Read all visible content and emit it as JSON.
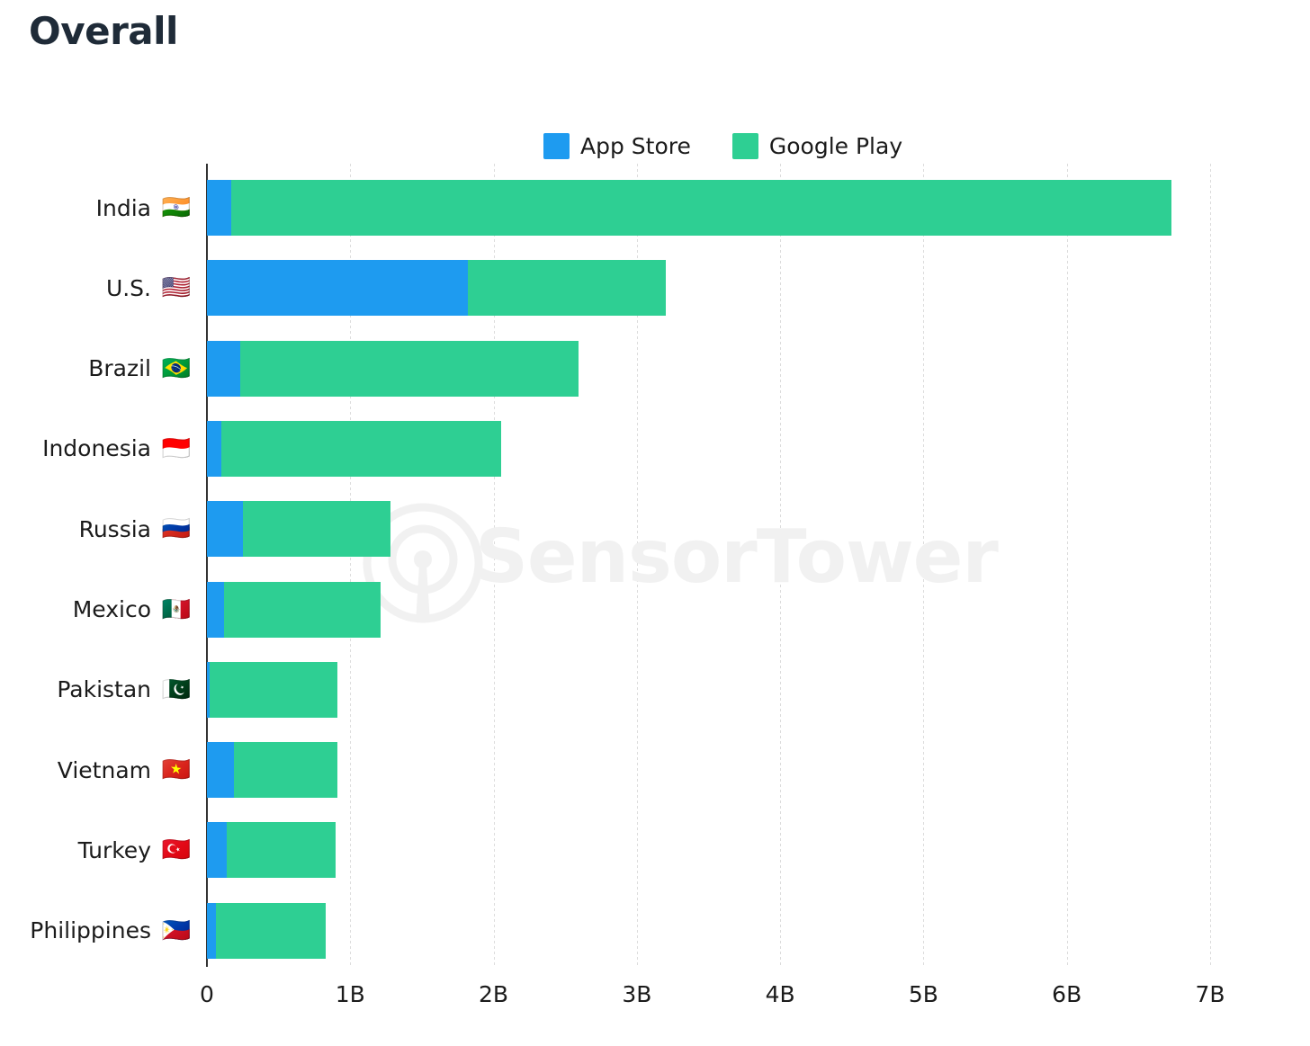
{
  "title": "Overall",
  "watermark": {
    "text": "SensorTower",
    "logo_icon": "sensortower-logo-icon",
    "color": "#f1f1f1"
  },
  "legend": {
    "position": "top-center",
    "items": [
      {
        "label": "App Store",
        "color": "#1e9bf0",
        "icon": "legend-swatch-app-store"
      },
      {
        "label": "Google Play",
        "color": "#2ecf93",
        "icon": "legend-swatch-google-play"
      }
    ]
  },
  "chart_data": {
    "type": "bar",
    "orientation": "horizontal",
    "stacked": true,
    "title": "Overall",
    "xlabel": "",
    "ylabel": "",
    "xlim": [
      0,
      7
    ],
    "units": "downloads (billions)",
    "grid": true,
    "x_ticks": [
      0,
      1,
      2,
      3,
      4,
      5,
      6,
      7
    ],
    "x_tick_labels": [
      "0",
      "1B",
      "2B",
      "3B",
      "4B",
      "5B",
      "6B",
      "7B"
    ],
    "categories": [
      "India",
      "U.S.",
      "Brazil",
      "Indonesia",
      "Russia",
      "Mexico",
      "Pakistan",
      "Vietnam",
      "Turkey",
      "Philippines"
    ],
    "category_flags": [
      "🇮🇳",
      "🇺🇸",
      "🇧🇷",
      "🇮🇩",
      "🇷🇺",
      "🇲🇽",
      "🇵🇰",
      "🇻🇳",
      "🇹🇷",
      "🇵🇭"
    ],
    "series": [
      {
        "name": "App Store",
        "color": "#1e9bf0",
        "values": [
          0.17,
          1.82,
          0.23,
          0.1,
          0.25,
          0.12,
          0.02,
          0.19,
          0.14,
          0.06
        ]
      },
      {
        "name": "Google Play",
        "color": "#2ecf93",
        "values": [
          6.56,
          1.38,
          2.36,
          1.95,
          1.03,
          1.09,
          0.89,
          0.72,
          0.76,
          0.77
        ]
      }
    ],
    "totals": [
      6.73,
      3.2,
      2.59,
      2.05,
      1.28,
      1.21,
      0.91,
      0.91,
      0.9,
      0.83
    ]
  }
}
